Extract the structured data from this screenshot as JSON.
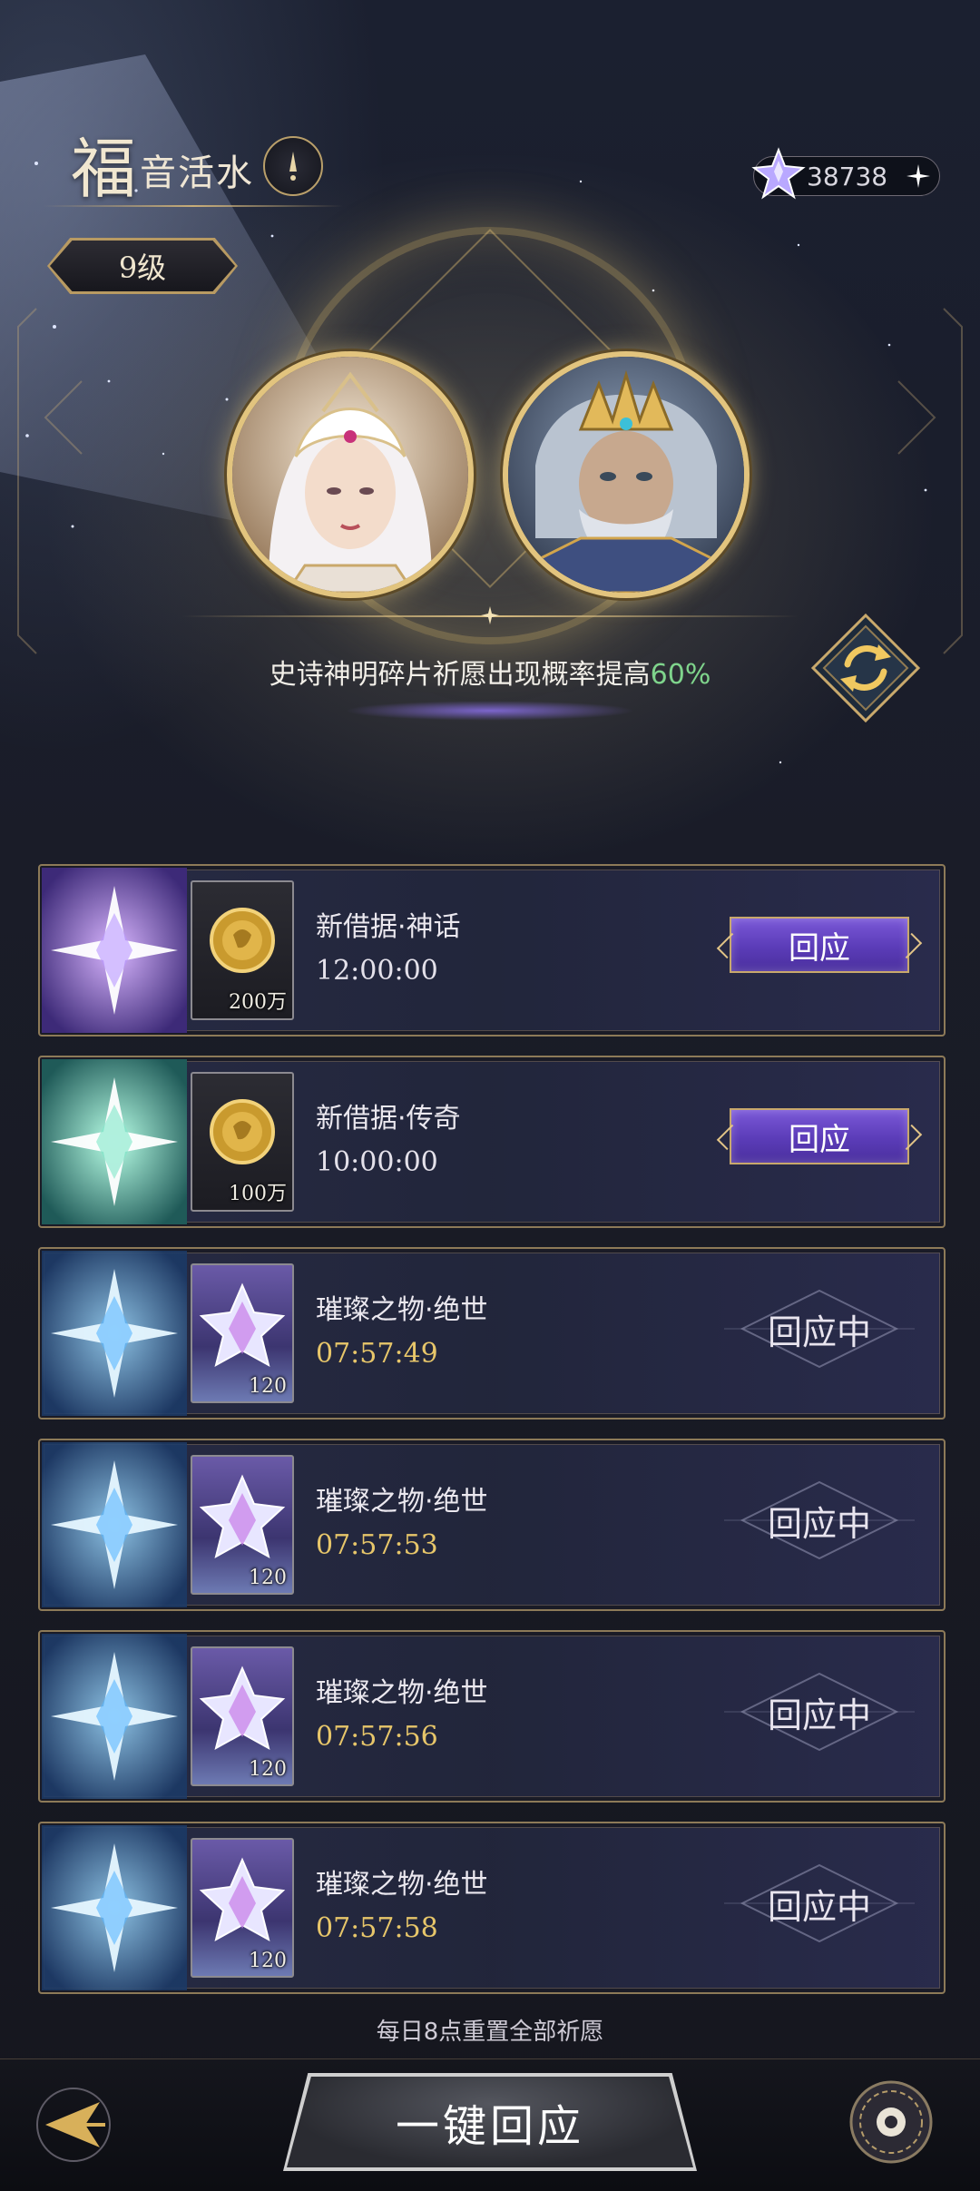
{
  "header": {
    "title_first": "福",
    "title_rest": "音活水",
    "level": "9级",
    "currency_value": "38738"
  },
  "banner": {
    "boost_text": "史诗神明碎片祈愿出现概率提高",
    "boost_percent": "60%"
  },
  "quests": [
    {
      "name": "新借据·神话",
      "time": "12:00:00",
      "reward": "200万",
      "reward_icon": "gold-coin-icon",
      "rarity": "mythic",
      "status_label": "回应",
      "state": "available"
    },
    {
      "name": "新借据·传奇",
      "time": "10:00:00",
      "reward": "100万",
      "reward_icon": "gold-coin-icon",
      "rarity": "legendary",
      "status_label": "回应",
      "state": "available"
    },
    {
      "name": "璀璨之物·绝世",
      "time": "07:57:49",
      "reward": "120",
      "reward_icon": "crystal-icon",
      "rarity": "peerless",
      "status_label": "回应中",
      "state": "in-progress"
    },
    {
      "name": "璀璨之物·绝世",
      "time": "07:57:53",
      "reward": "120",
      "reward_icon": "crystal-icon",
      "rarity": "peerless",
      "status_label": "回应中",
      "state": "in-progress"
    },
    {
      "name": "璀璨之物·绝世",
      "time": "07:57:56",
      "reward": "120",
      "reward_icon": "crystal-icon",
      "rarity": "peerless",
      "status_label": "回应中",
      "state": "in-progress"
    },
    {
      "name": "璀璨之物·绝世",
      "time": "07:57:58",
      "reward": "120",
      "reward_icon": "crystal-icon",
      "rarity": "peerless",
      "status_label": "回应中",
      "state": "in-progress"
    }
  ],
  "footer": {
    "reset_note": "每日8点重置全部祈愿",
    "one_key_label": "一键回应"
  },
  "colors": {
    "accent_gold": "#e2c47e",
    "button_purple": "#5b3cb8",
    "boost_green": "#7fd48c",
    "timer_gold": "#e7c66a"
  }
}
